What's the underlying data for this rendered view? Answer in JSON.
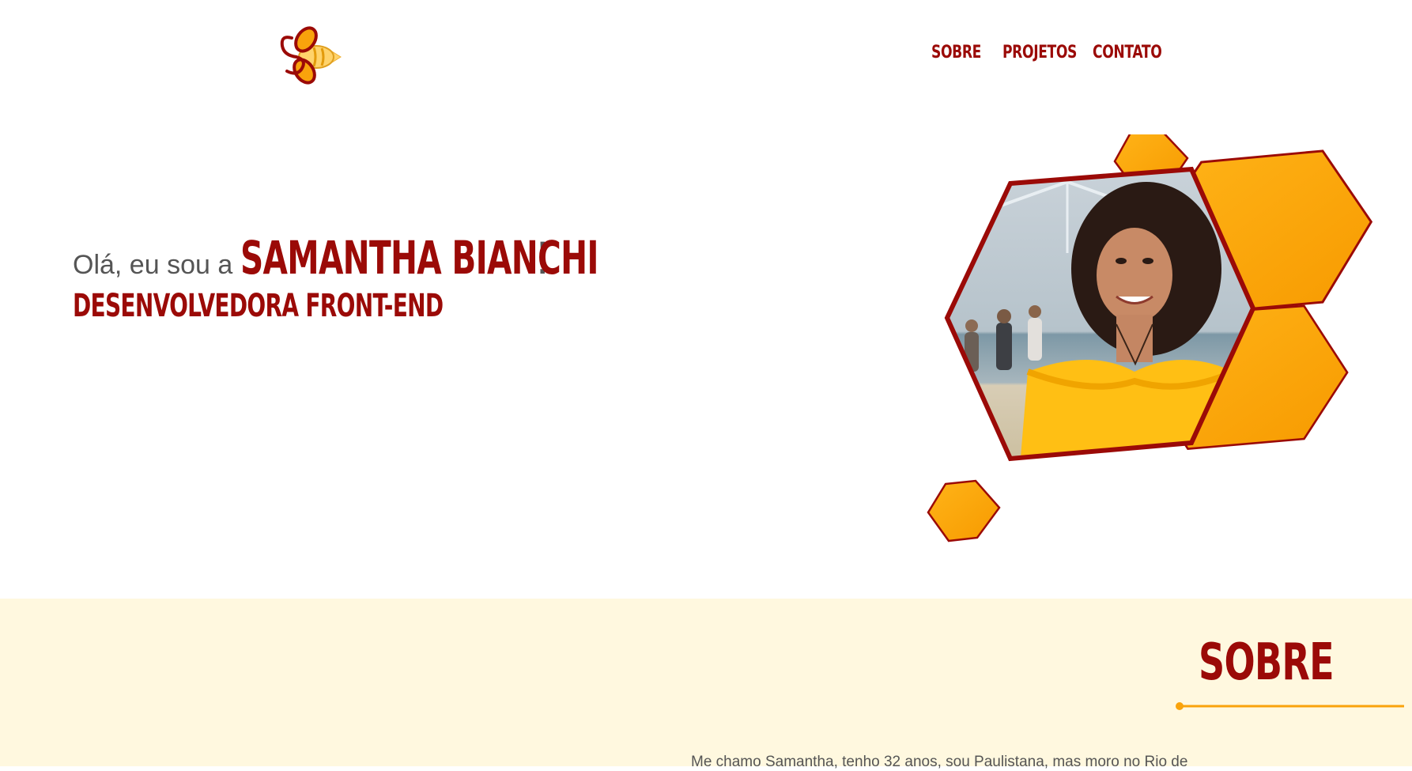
{
  "nav": {
    "items": [
      {
        "label": "SOBRE"
      },
      {
        "label": "PROJETOS"
      },
      {
        "label": "CONTATO"
      }
    ]
  },
  "hero": {
    "greeting": "Olá, eu sou a",
    "name": "SAMANTHA BIANCHI",
    "exclamation": "!",
    "role": "DESENVOLVEDORA FRONT-END"
  },
  "about": {
    "title": "SOBRE",
    "text": "Me chamo Samantha, tenho 32 anos, sou Paulistana, mas moro no Rio de"
  },
  "colors": {
    "brand": "#9b0a07",
    "accent": "#f9a30c",
    "about_background": "#fff8df"
  }
}
